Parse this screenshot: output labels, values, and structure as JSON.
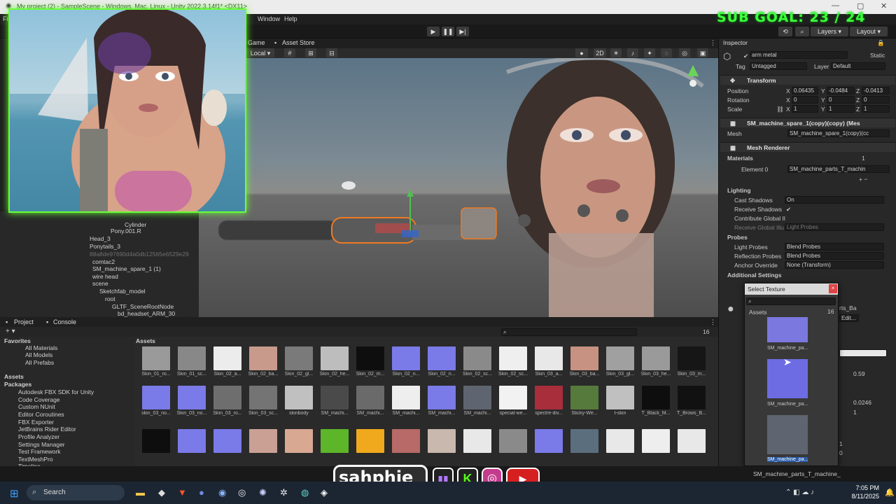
{
  "titlebar": {
    "title": "My project (2) - SampleScene - Windows, Mac, Linux - Unity 2022.3.14f1* <DX11>"
  },
  "menu": {
    "items": [
      "File",
      "Window",
      "Help"
    ]
  },
  "toolbar": {
    "layers": "Layers",
    "layout": "Layout"
  },
  "overlay": {
    "sub_goal": "SUB GOAL: 23 / 24",
    "handle": "sahphie"
  },
  "scene": {
    "tab_game": "Game",
    "tab_asset_store": "Asset Store",
    "pivot": "Local",
    "mode_2d": "2D"
  },
  "hierarchy": {
    "items": [
      "Cylinder",
      "Pony.001.R",
      "Head_3",
      "Ponytails_3",
      "88a8de97690d4a0db12565e6529e29",
      "comtac2",
      "SM_machine_spare_1 (1)",
      "wire head",
      "scene",
      "Sketchfab_model",
      "root",
      "GLTF_SceneRootNode",
      "bd_headset_ARM_30"
    ]
  },
  "project": {
    "tab_project": "Project",
    "tab_console": "Console",
    "favorites_title": "Favorites",
    "favorites": [
      "All Materials",
      "All Models",
      "All Prefabs"
    ],
    "assets_title": "Assets",
    "packages_title": "Packages",
    "packages": [
      "Autodesk FBX SDK for Unity",
      "Code Coverage",
      "Custom NUnit",
      "Editor Coroutines",
      "FBX Exporter",
      "JetBrains Rider Editor",
      "Profile Analyzer",
      "Settings Manager",
      "Test Framework",
      "TextMeshPro",
      "Timeline"
    ],
    "breadcrumb": "Assets",
    "count": "16",
    "row1": [
      "Skin_01_ro...",
      "Skin_01_sc...",
      "Skin_02_a...",
      "Skin_02_ba...",
      "Skin_02_gl...",
      "Skin_02_he...",
      "Skin_02_m...",
      "Skin_02_n...",
      "Skin_02_n...",
      "Skin_02_sc...",
      "Skin_02_sc...",
      "Skin_03_a...",
      "Skin_03_ba...",
      "Skin_03_gl...",
      "Skin_03_he...",
      "Skin_03_m..."
    ],
    "row2": [
      "skin_03_no...",
      "Skin_03_no...",
      "Skin_03_ro...",
      "Skin_03_sc...",
      "skinbody",
      "SM_machi...",
      "SM_machi...",
      "SM_machi...",
      "SM_machi...",
      "SM_machi...",
      "special-we...",
      "spectre-div...",
      "Sticky-We...",
      "t-skin",
      "T_Black_M...",
      "T_Brows_B..."
    ]
  },
  "inspector": {
    "tab": "Inspector",
    "object_name": "arm metal",
    "static": "Static",
    "tag_label": "Tag",
    "tag_value": "Untagged",
    "layer_label": "Layer",
    "layer_value": "Default",
    "transform": "Transform",
    "position": "Position",
    "pos_x": "0.06435",
    "pos_y": "-0.0484",
    "pos_z": "-0.0413",
    "rotation": "Rotation",
    "rot_x": "0",
    "rot_y": "0",
    "rot_z": "0",
    "scale": "Scale",
    "scl_x": "1",
    "scl_y": "1",
    "scl_z": "1",
    "mesh_filter": "SM_machine_spare_1(copy)(copy) (Mes",
    "mesh_label": "Mesh",
    "mesh_value": "SM_machine_spare_1(copy)(cc",
    "mesh_renderer": "Mesh Renderer",
    "materials": "Materials",
    "materials_count": "1",
    "element0": "Element 0",
    "element0_value": "SM_machine_parts_T_machin",
    "lighting": "Lighting",
    "cast_shadows": "Cast Shadows",
    "cast_shadows_value": "On",
    "receive_shadows": "Receive Shadows",
    "contribute_gi": "Contribute Global Il",
    "receive_gi": "Receive Global Illu",
    "receive_gi_value": "Light Probes",
    "probes": "Probes",
    "light_probes": "Light Probes",
    "light_probes_value": "Blend Probes",
    "reflection_probes": "Reflection Probes",
    "reflection_probes_value": "Blend Probes",
    "anchor_override": "Anchor Override",
    "anchor_value": "None (Transform)",
    "additional": "Additional Settings",
    "material_title": "rts_Ba",
    "edit": "Edit...",
    "val1": "0.59",
    "val2": "0.0246",
    "val3": "1",
    "val4": "1",
    "val5": "0"
  },
  "popup": {
    "title": "Select Texture",
    "assets": "Assets",
    "count": "16",
    "items": [
      "SM_machine_pa...",
      "SM_machine_pa...",
      "SM_machine_pa..."
    ]
  },
  "status": {
    "selected": "SM_machine_parts_T_machine_"
  },
  "taskbar": {
    "search": "Search",
    "time": "7:05 PM",
    "date": "8/11/2025"
  }
}
